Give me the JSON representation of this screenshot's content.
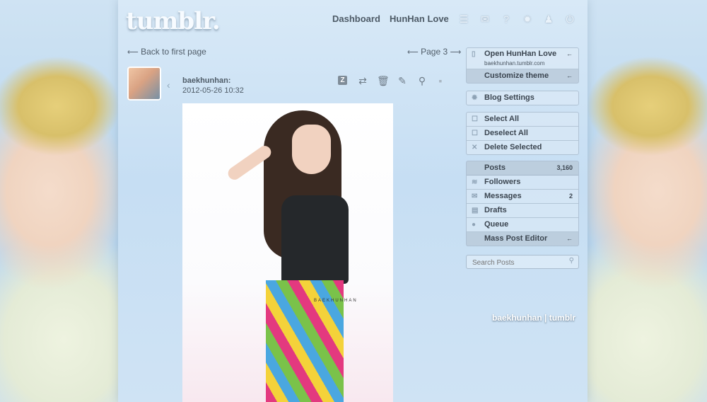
{
  "header": {
    "logo_text": "tumblr.",
    "nav": [
      "Dashboard",
      "HunHan Love"
    ],
    "icons": [
      "list-icon",
      "mail-icon",
      "help-icon",
      "gear-icon",
      "people-icon",
      "power-icon"
    ]
  },
  "pager": {
    "back": "Back to first page",
    "page": "Page 3"
  },
  "post": {
    "username": "baekhunhan:",
    "date": "2012-05-26 10:32",
    "watermark": "BAEKHUNHAN",
    "controls": [
      "notes-icon",
      "reblog-icon",
      "delete-icon",
      "edit-icon",
      "search-icon",
      "square-icon"
    ]
  },
  "sidebar": {
    "blog_links": {
      "open_label": "Open HunHan Love",
      "open_url": "baekhunhan.tumblr.com",
      "customize_label": "Customize theme",
      "arrow": "←"
    },
    "settings_label": "Blog Settings",
    "selection": [
      "Select All",
      "Deselect All",
      "Delete Selected"
    ],
    "stats": [
      {
        "label": "Posts",
        "value": "3,160"
      },
      {
        "label": "Followers",
        "value": ""
      },
      {
        "label": "Messages",
        "value": "2"
      },
      {
        "label": "Drafts",
        "value": ""
      },
      {
        "label": "Queue",
        "value": ""
      },
      {
        "label": "Mass Post Editor",
        "value": "←"
      }
    ],
    "search_placeholder": "Search Posts"
  },
  "credit": "baekhunhan | tumblr",
  "colors": {
    "text_dark": "#3b4550",
    "panel_border": "#96aabe"
  }
}
